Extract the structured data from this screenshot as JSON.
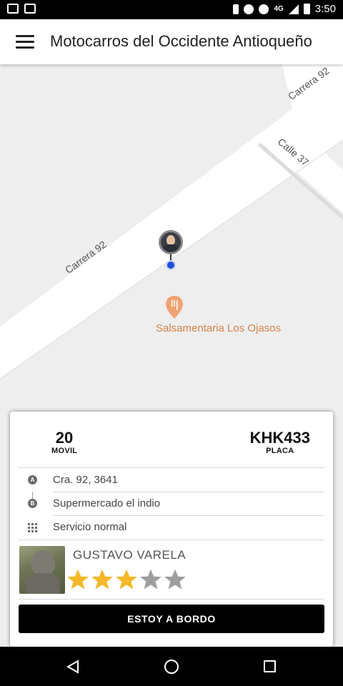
{
  "status_bar": {
    "time": "3:50",
    "network": "4G"
  },
  "app_bar": {
    "title": "Motocarros del Occidente Antioqueño"
  },
  "map": {
    "streets": [
      "Carrera 92",
      "Carrera 92",
      "Calle 37"
    ],
    "poi": {
      "name": "Salsamentaria Los Ojasos"
    },
    "colors": {
      "background": "#eeeeee",
      "road": "#ffffff",
      "poi": "#d4834a",
      "pin": "#1e4fd8"
    }
  },
  "trip": {
    "movil_number": "20",
    "movil_label": "MOVIL",
    "plate": "KHK433",
    "plate_label": "PLACA",
    "origin": "Cra. 92, 3641",
    "destination": "Supermercado el indio",
    "service": "Servicio normal",
    "origin_marker": "A",
    "destination_marker": "B"
  },
  "driver": {
    "name": "GUSTAVO VARELA",
    "rating": 3,
    "rating_max": 5,
    "star_color": "#f5b829",
    "star_empty_color": "#9e9e9e"
  },
  "actions": {
    "board_button": "ESTOY A BORDO"
  }
}
